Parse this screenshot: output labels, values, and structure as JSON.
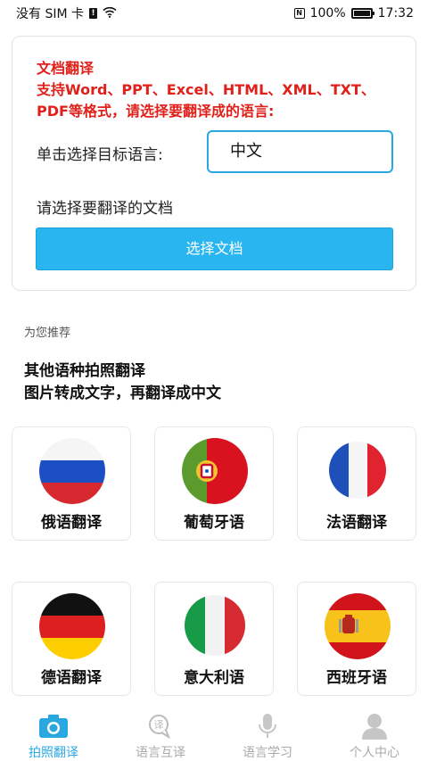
{
  "status_bar": {
    "carrier": "没有 SIM 卡",
    "sim_badge": "!",
    "battery": "100%",
    "battery_level": 1.0,
    "time": "17:32"
  },
  "card": {
    "title": "文档翻译",
    "description": "支持Word、PPT、Excel、HTML、XML、TXT、PDF等格式，请选择要翻译成的语言:",
    "target_label": "单击选择目标语言:",
    "target_value": "中文",
    "doc_label": "请选择要翻译的文档",
    "select_button": "选择文档"
  },
  "section_label": "为您推荐",
  "promo": {
    "line1": "其他语种拍照翻译",
    "line2": "图片转成文字，再翻译成中文"
  },
  "languages": [
    {
      "label": "俄语翻译",
      "flag": "russia-flag-icon"
    },
    {
      "label": "葡萄牙语",
      "flag": "portugal-flag-icon"
    },
    {
      "label": "法语翻译",
      "flag": "france-flag-icon"
    },
    {
      "label": "德语翻译",
      "flag": "germany-flag-icon"
    },
    {
      "label": "意大利语",
      "flag": "italy-flag-icon"
    },
    {
      "label": "西班牙语",
      "flag": "spain-flag-icon"
    }
  ],
  "bottom_nav": [
    {
      "label": "拍照翻译",
      "icon": "camera-icon",
      "active": true
    },
    {
      "label": "语言互译",
      "icon": "translate-bubble-icon",
      "active": false
    },
    {
      "label": "语言学习",
      "icon": "microphone-icon",
      "active": false
    },
    {
      "label": "个人中心",
      "icon": "user-icon",
      "active": false
    }
  ],
  "colors": {
    "accent": "#29a8e0",
    "button": "#29b6f0",
    "title_red": "#e0201a"
  }
}
